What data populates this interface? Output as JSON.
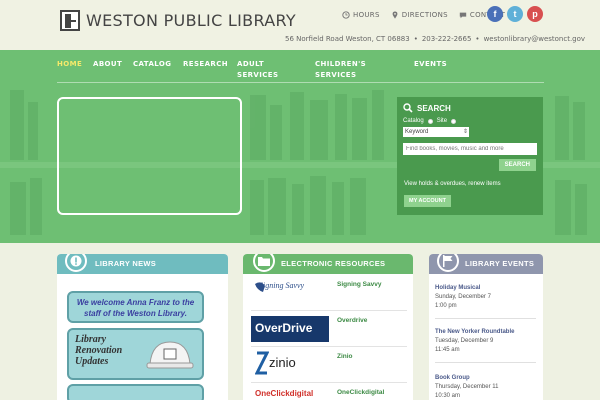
{
  "site": {
    "title": "WESTON PUBLIC LIBRARY"
  },
  "top_links": [
    {
      "label": "HOURS",
      "icon": "clock-icon"
    },
    {
      "label": "DIRECTIONS",
      "icon": "map-pin-icon"
    },
    {
      "label": "CONTACT",
      "icon": "chat-icon"
    }
  ],
  "social": [
    {
      "label": "f",
      "icon": "facebook-icon",
      "color": "#4a70b8"
    },
    {
      "label": "t",
      "icon": "twitter-icon",
      "color": "#5fb0d8"
    },
    {
      "label": "p",
      "icon": "pinterest-icon",
      "color": "#d85050"
    }
  ],
  "address": {
    "street": "56 Norfield Road Weston, CT 06883",
    "phone": "203-222-2665",
    "email": "westonlibrary@westonct.gov",
    "separator": "•"
  },
  "nav": [
    "HOME",
    "ABOUT",
    "CATALOG",
    "RESEARCH",
    "ADULT SERVICES",
    "CHILDREN'S SERVICES",
    "EVENTS"
  ],
  "search": {
    "title": "SEARCH",
    "radio_catalog": "Catalog",
    "radio_site": "Site",
    "select_value": "Keyword",
    "input_placeholder": "Find books, movies, music and more",
    "button": "SEARCH",
    "holds_link": "View holds & overdues, renew items",
    "account_button": "MY ACCOUNT"
  },
  "news": {
    "title": "LIBRARY NEWS",
    "banner1": "We welcome Anna Franz to the staff of the Weston Library.",
    "banner2_line1": "Library",
    "banner2_line2": "Renovation",
    "banner2_line3": "Updates"
  },
  "resources": {
    "title": "ELECTRONIC RESOURCES",
    "items": [
      {
        "name": "Signing Savvy",
        "logo": "Signing Savvy"
      },
      {
        "name": "Overdrive",
        "logo": "OverDrive"
      },
      {
        "name": "Zinio",
        "logo": "zinio"
      },
      {
        "name": "OneClickdigital",
        "logo": "OneClickdigital"
      }
    ]
  },
  "events": {
    "title": "LIBRARY EVENTS",
    "items": [
      {
        "name": "Holiday Musical",
        "date": "Sunday, December 7",
        "time": "1:00 pm"
      },
      {
        "name": "The New Yorker Roundtable",
        "date": "Tuesday, December 9",
        "time": "11:45 am"
      },
      {
        "name": "Book Group",
        "date": "Thursday, December 11",
        "time": "10:30 am"
      }
    ]
  },
  "colors": {
    "hero_green": "#6ebf73",
    "search_green": "#4a9a4e",
    "news_teal": "#6fbcbf",
    "resources_green": "#6ab86e",
    "events_slate": "#8f96ad",
    "nav_active": "#f5e96a"
  }
}
